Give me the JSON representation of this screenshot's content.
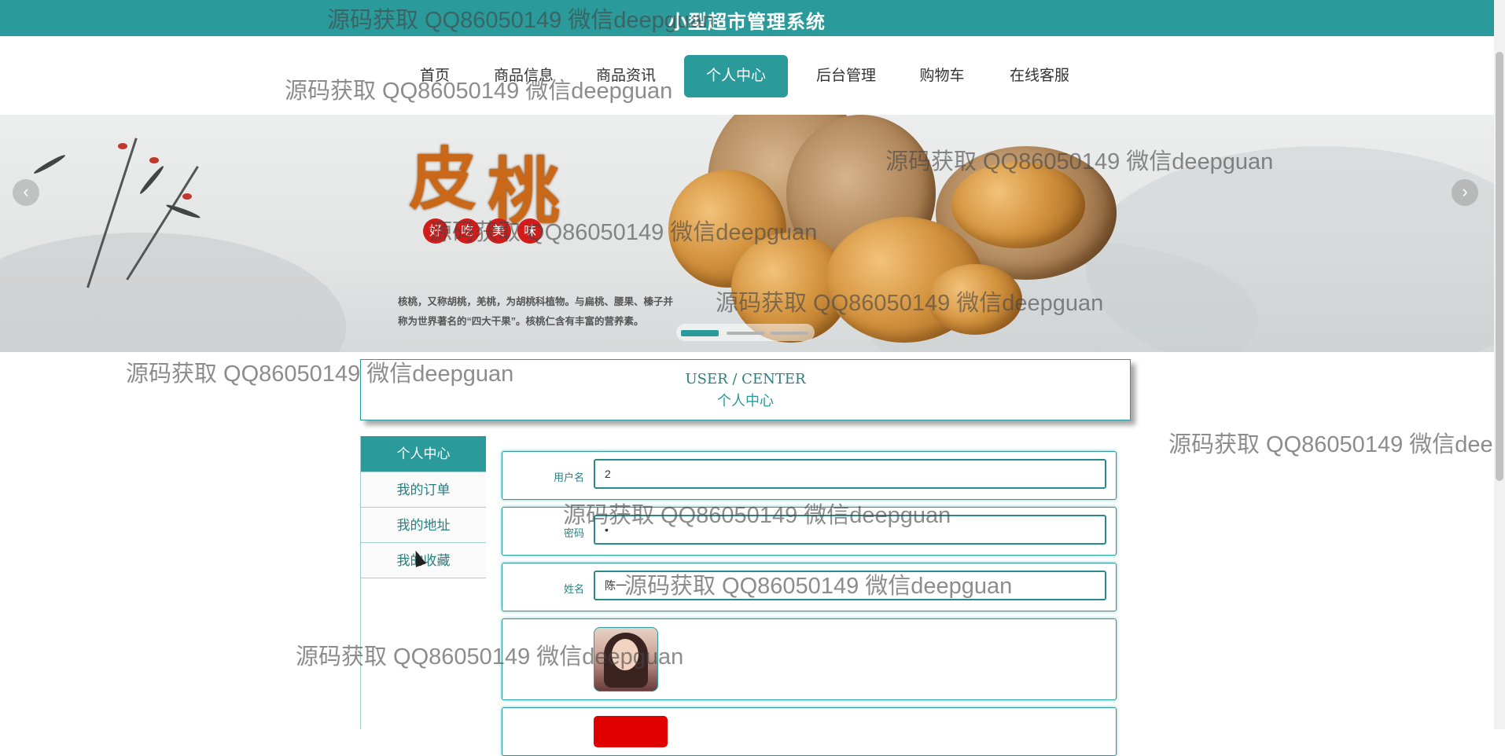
{
  "app": {
    "title": "小型超市管理系统"
  },
  "nav": {
    "items": [
      {
        "label": "首页",
        "active": false
      },
      {
        "label": "商品信息",
        "active": false
      },
      {
        "label": "商品资讯",
        "active": false
      },
      {
        "label": "个人中心",
        "active": true
      },
      {
        "label": "后台管理",
        "active": false
      },
      {
        "label": "购物车",
        "active": false
      },
      {
        "label": "在线客服",
        "active": false
      }
    ]
  },
  "banner": {
    "title_chars": [
      "皮",
      "桃"
    ],
    "seal_chars": [
      "好",
      "吃",
      "美",
      "味"
    ],
    "description_line1": "核桃，又称胡桃，羌桃，为胡桃科植物。与扁桃、腰果、榛子并",
    "description_line2": "称为世界著名的“四大干果”。核桃仁含有丰富的营养素。",
    "slides_total": 3,
    "slide_active": 1,
    "prev_icon": "chevron-left-icon",
    "next_icon": "chevron-right-icon"
  },
  "center_header": {
    "en": "USER / CENTER",
    "zh": "个人中心"
  },
  "sidebar": {
    "items": [
      {
        "label": "个人中心",
        "active": true
      },
      {
        "label": "我的订单",
        "active": false
      },
      {
        "label": "我的地址",
        "active": false
      },
      {
        "label": "我的收藏",
        "active": false
      }
    ]
  },
  "form": {
    "username": {
      "label": "用户名",
      "value": "2"
    },
    "password": {
      "label": "密码",
      "value": "•"
    },
    "name": {
      "label": "姓名",
      "value": "陈一"
    },
    "avatar": {
      "icon": "avatar-photo"
    }
  },
  "watermark": {
    "text": "源码获取 QQ86050149 微信deepguan"
  },
  "colors": {
    "primary": "#2a9a9a",
    "save_button": "#e00000"
  }
}
